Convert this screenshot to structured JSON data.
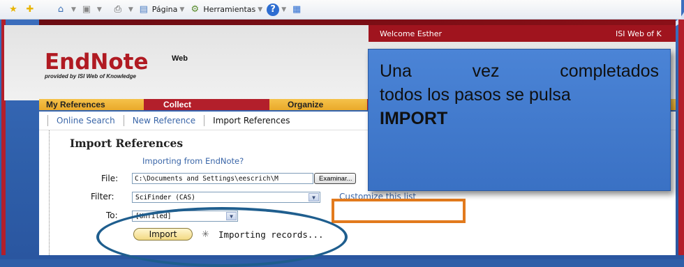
{
  "browser_toolbar": {
    "items": [
      {
        "icon": "favorites-star-icon"
      },
      {
        "icon": "add-favorite-icon"
      },
      {
        "icon": "home-icon"
      },
      {
        "icon": "feeds-icon"
      },
      {
        "icon": "print-icon"
      },
      {
        "label": "Página",
        "icon": "page-icon"
      },
      {
        "label": "Herramientas",
        "icon": "tools-gear-icon"
      },
      {
        "icon": "help-icon"
      },
      {
        "icon": "research-icon"
      }
    ],
    "page_label": "Página",
    "tools_label": "Herramientas",
    "help_glyph": "?"
  },
  "site": {
    "welcome": "Welcome Esther",
    "isi": "ISI Web of K",
    "logo_main": "EndNote",
    "logo_web": "Web",
    "logo_sub": "provided by ISI Web of Knowledge"
  },
  "tabs": [
    {
      "label": "My References"
    },
    {
      "label": "Collect"
    },
    {
      "label": "Organize"
    }
  ],
  "subnav": {
    "online_search": "Online Search",
    "new_reference": "New Reference",
    "import_references": "Import References"
  },
  "form": {
    "title": "Import References",
    "importing_link": "Importing from EndNote?",
    "file_label": "File:",
    "file_value": "C:\\Documents and Settings\\eescrich\\M",
    "browse_label": "Examinar...",
    "filter_label": "Filter:",
    "filter_value": "SciFinder (CAS)",
    "customize_link": "Customize this list",
    "to_label": "To:",
    "to_value": "[Unfiled]",
    "import_button": "Import",
    "importing_status": "Importing records..."
  },
  "callout": {
    "line1_words": [
      "Una",
      "vez",
      "completados"
    ],
    "line2": "todos los pasos se pulsa",
    "line3": "IMPORT"
  },
  "colors": {
    "site_red": "#b31f2b",
    "tab_gold": "#f5c24a",
    "link_blue": "#3a66a8",
    "callout_blue": "#4b84d6",
    "ellipse_blue": "#1f5e8e",
    "highlight_orange": "#e27a1d"
  }
}
